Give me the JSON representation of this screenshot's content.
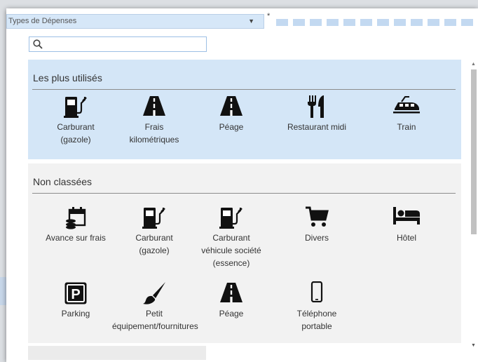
{
  "type_selector": {
    "placeholder": "Types de Dépenses",
    "required_mark": "*"
  },
  "search": {
    "value": "",
    "placeholder": ""
  },
  "favorites": {
    "title": "Les plus utilisés",
    "items": [
      {
        "icon": "fuel-pump-icon",
        "label": "Carburant\n(gazole)"
      },
      {
        "icon": "road-icon",
        "label": "Frais\nkilométriques"
      },
      {
        "icon": "road-icon",
        "label": "Péage"
      },
      {
        "icon": "utensils-icon",
        "label": "Restaurant midi"
      },
      {
        "icon": "train-icon",
        "label": "Train"
      }
    ]
  },
  "unclassified": {
    "title": "Non classées",
    "items": [
      {
        "icon": "calendar-coins-icon",
        "label": "Avance sur frais"
      },
      {
        "icon": "fuel-pump-icon",
        "label": "Carburant\n(gazole)"
      },
      {
        "icon": "fuel-pump-icon",
        "label": "Carburant\nvéhicule société\n(essence)"
      },
      {
        "icon": "shopping-cart-icon",
        "label": "Divers"
      },
      {
        "icon": "bed-icon",
        "label": "Hôtel"
      },
      {
        "icon": "parking-icon",
        "label": "Parking"
      },
      {
        "icon": "paint-brush-icon",
        "label": "Petit\néquipement/fournitures"
      },
      {
        "icon": "road-icon",
        "label": "Péage"
      },
      {
        "icon": "mobile-phone-icon",
        "label": "Téléphone\nportable"
      }
    ]
  }
}
